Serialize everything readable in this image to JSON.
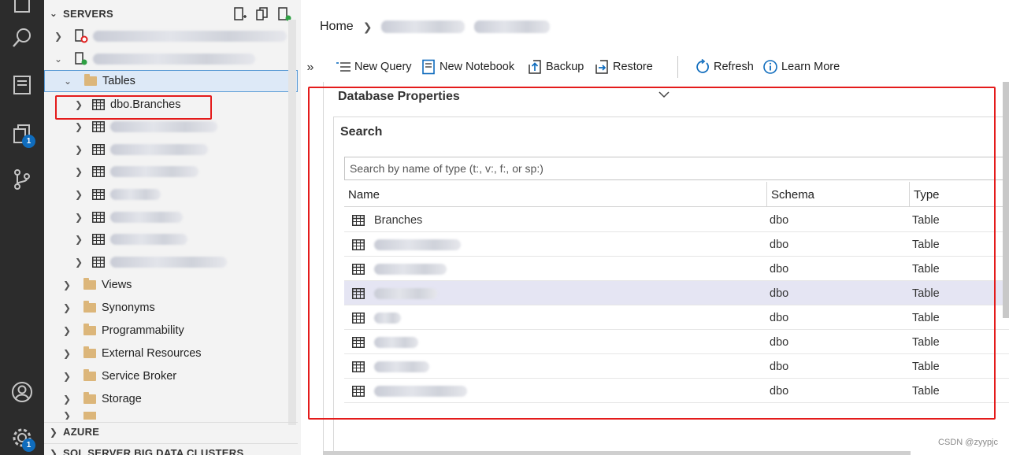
{
  "activity_bar": {
    "icons": [
      "explorer-icon",
      "search-icon",
      "notebook-icon",
      "connections-icon",
      "source-control-icon",
      "account-icon",
      "settings-icon"
    ],
    "connections_badge": "1",
    "settings_badge": "1"
  },
  "sidebar": {
    "servers_header": "SERVERS",
    "tables_label": "Tables",
    "selected_table": "dbo.Branches",
    "folders": [
      "Views",
      "Synonyms",
      "Programmability",
      "External Resources",
      "Service Broker",
      "Storage"
    ],
    "azure_header": "AZURE",
    "bdc_header": "SQL SERVER BIG DATA CLUSTERS"
  },
  "main": {
    "breadcrumb_home": "Home",
    "toolbar": {
      "new_query": "New Query",
      "new_notebook": "New Notebook",
      "backup": "Backup",
      "restore": "Restore",
      "refresh": "Refresh",
      "learn_more": "Learn More"
    },
    "properties_header": "Database Properties",
    "search_title": "Search",
    "search_placeholder": "Search by name of type (t:, v:, f:, or sp:)",
    "columns": [
      "Name",
      "Schema",
      "Type"
    ],
    "rows": [
      {
        "name": "Branches",
        "schema": "dbo",
        "type": "Table"
      },
      {
        "name": "",
        "schema": "dbo",
        "type": "Table"
      },
      {
        "name": "",
        "schema": "dbo",
        "type": "Table"
      },
      {
        "name": "",
        "schema": "dbo",
        "type": "Table"
      },
      {
        "name": "",
        "schema": "dbo",
        "type": "Table"
      },
      {
        "name": "",
        "schema": "dbo",
        "type": "Table"
      },
      {
        "name": "",
        "schema": "dbo",
        "type": "Table"
      },
      {
        "name": "",
        "schema": "dbo",
        "type": "Table"
      }
    ]
  },
  "watermark": "CSDN @zyypjc",
  "colors": {
    "accent": "#0f6cbd",
    "highlight_box": "#e41b1b",
    "folder": "#dcb67a"
  }
}
